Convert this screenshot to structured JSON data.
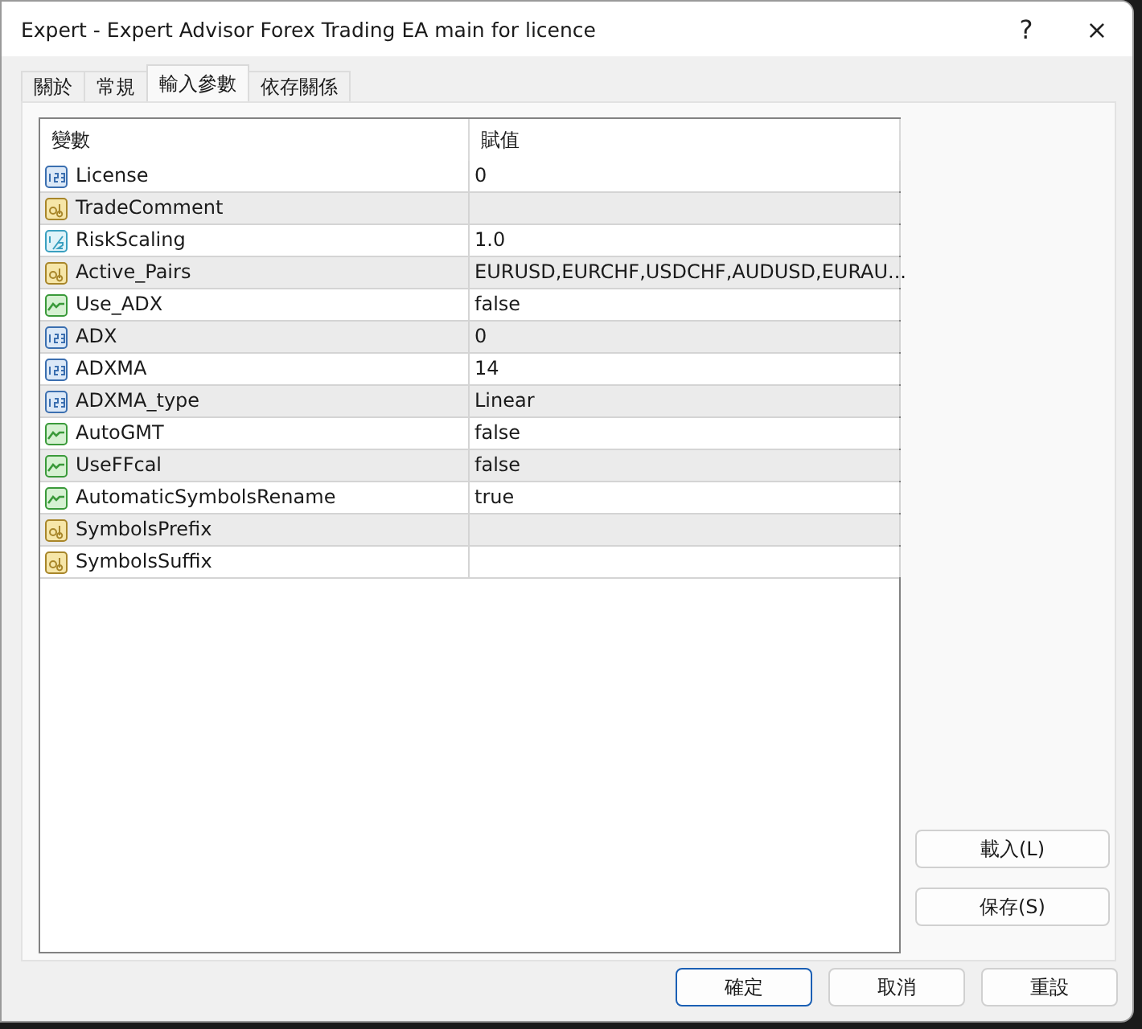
{
  "window": {
    "title": "Expert - Expert Advisor Forex Trading EA main for licence",
    "help": "?",
    "close": "×"
  },
  "tabs": [
    {
      "label": "關於",
      "selected": false
    },
    {
      "label": "常規",
      "selected": false
    },
    {
      "label": "輸入參數",
      "selected": true
    },
    {
      "label": "依存關係",
      "selected": false
    }
  ],
  "table": {
    "columns": [
      "變數",
      "賦值"
    ],
    "rows": [
      {
        "kind": "int",
        "name": "License",
        "value": "0"
      },
      {
        "kind": "string",
        "name": "TradeComment"
      },
      {
        "kind": "double",
        "name": "RiskScaling",
        "value": "1.0"
      },
      {
        "kind": "string",
        "name": "Active_Pairs",
        "value": "EURUSD,EURCHF,USDCHF,AUDUSD,EURAU..."
      },
      {
        "kind": "bool",
        "name": "Use_ADX",
        "value": "false"
      },
      {
        "kind": "int",
        "name": "ADX",
        "value": "0"
      },
      {
        "kind": "int",
        "name": "ADXMA",
        "value": "14"
      },
      {
        "kind": "int",
        "name": "ADXMA_type",
        "value": "Linear"
      },
      {
        "kind": "bool",
        "name": "AutoGMT",
        "value": "false"
      },
      {
        "kind": "bool",
        "name": "UseFFcal",
        "value": "false"
      },
      {
        "kind": "bool",
        "name": "AutomaticSymbolsRename",
        "value": "true"
      },
      {
        "kind": "string",
        "name": "SymbolsPrefix"
      },
      {
        "kind": "string",
        "name": "SymbolsSuffix"
      }
    ]
  },
  "side_buttons": [
    "載入(L)",
    "保存(S)"
  ],
  "buttons": [
    {
      "label": "確定",
      "default": true
    },
    {
      "label": "取消",
      "default": false
    },
    {
      "label": "重設",
      "default": false
    }
  ]
}
